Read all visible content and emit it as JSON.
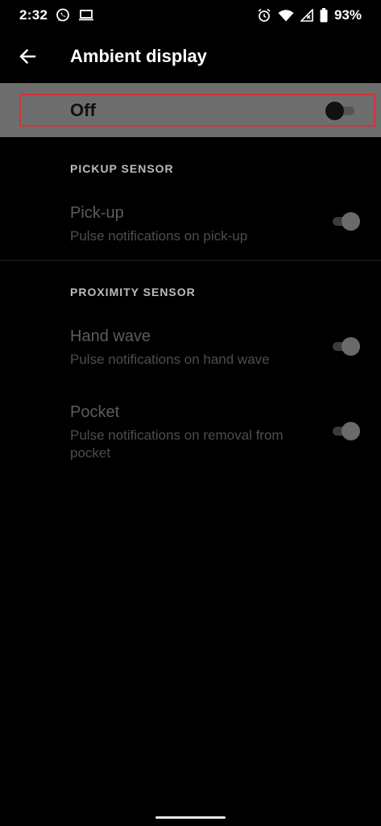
{
  "status_bar": {
    "time": "2:32",
    "battery_percent": "93%",
    "icons": [
      "whatsapp-icon",
      "laptop-icon",
      "alarm-icon",
      "wifi-icon",
      "signal-icon",
      "battery-icon"
    ]
  },
  "app_bar": {
    "title": "Ambient display",
    "back_icon": "arrow-back-icon"
  },
  "master_switch": {
    "label": "Off",
    "checked": false,
    "highlight_color": "#d0343c"
  },
  "sections": [
    {
      "header": "PICKUP SENSOR",
      "items": [
        {
          "title": "Pick-up",
          "summary": "Pulse notifications on pick-up",
          "checked": true,
          "enabled": false
        }
      ]
    },
    {
      "header": "PROXIMITY SENSOR",
      "items": [
        {
          "title": "Hand wave",
          "summary": "Pulse notifications on hand wave",
          "checked": true,
          "enabled": false
        },
        {
          "title": "Pocket",
          "summary": "Pulse notifications on removal from pocket",
          "checked": true,
          "enabled": false
        }
      ]
    }
  ]
}
